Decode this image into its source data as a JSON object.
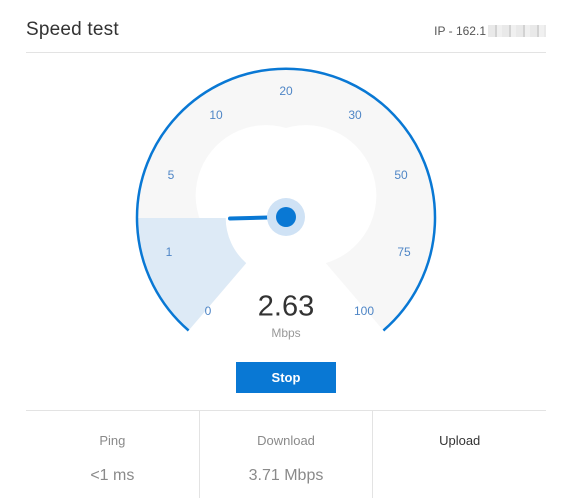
{
  "header": {
    "title": "Speed test",
    "ip_label": "IP - 162.1"
  },
  "gauge": {
    "ticks": [
      "0",
      "1",
      "5",
      "10",
      "20",
      "30",
      "50",
      "75",
      "100"
    ],
    "needle_value": 2.63,
    "value": "2.63",
    "unit": "Mbps",
    "colors": {
      "accent": "#0978d4",
      "fill": "#ddeaf6",
      "face": "#f7f7f7",
      "hub_halo": "#cfe2f5"
    }
  },
  "controls": {
    "stop_label": "Stop"
  },
  "stats": [
    {
      "label": "Ping",
      "value": "<1 ms",
      "active": false
    },
    {
      "label": "Download",
      "value": "3.71 Mbps",
      "active": false
    },
    {
      "label": "Upload",
      "value": "",
      "active": true
    }
  ]
}
